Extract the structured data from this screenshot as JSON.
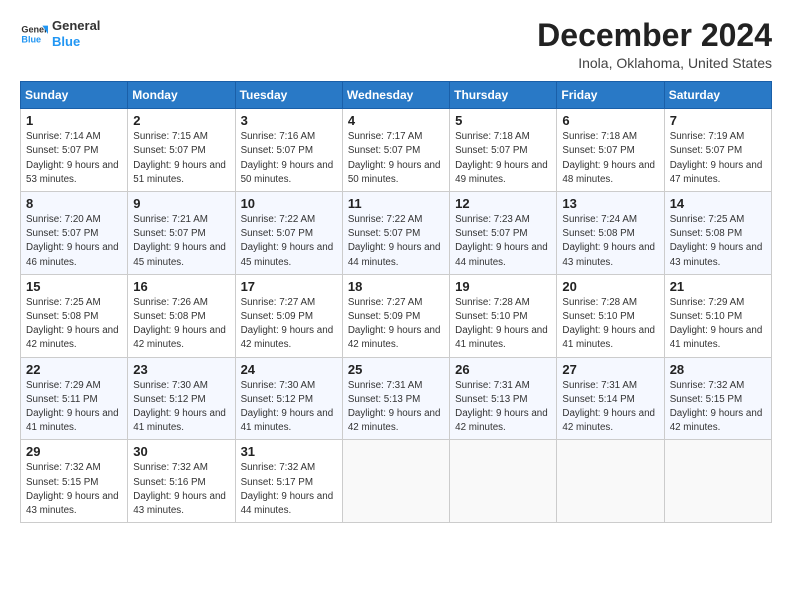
{
  "header": {
    "logo_line1": "General",
    "logo_line2": "Blue",
    "title": "December 2024",
    "subtitle": "Inola, Oklahoma, United States"
  },
  "calendar": {
    "headers": [
      "Sunday",
      "Monday",
      "Tuesday",
      "Wednesday",
      "Thursday",
      "Friday",
      "Saturday"
    ],
    "weeks": [
      [
        null,
        {
          "day": "2",
          "sunrise": "7:15 AM",
          "sunset": "5:07 PM",
          "daylight": "9 hours and 51 minutes."
        },
        {
          "day": "3",
          "sunrise": "7:16 AM",
          "sunset": "5:07 PM",
          "daylight": "9 hours and 50 minutes."
        },
        {
          "day": "4",
          "sunrise": "7:17 AM",
          "sunset": "5:07 PM",
          "daylight": "9 hours and 50 minutes."
        },
        {
          "day": "5",
          "sunrise": "7:18 AM",
          "sunset": "5:07 PM",
          "daylight": "9 hours and 49 minutes."
        },
        {
          "day": "6",
          "sunrise": "7:18 AM",
          "sunset": "5:07 PM",
          "daylight": "9 hours and 48 minutes."
        },
        {
          "day": "7",
          "sunrise": "7:19 AM",
          "sunset": "5:07 PM",
          "daylight": "9 hours and 47 minutes."
        }
      ],
      [
        {
          "day": "1",
          "sunrise": "7:14 AM",
          "sunset": "5:07 PM",
          "daylight": "9 hours and 53 minutes."
        },
        {
          "day": "9",
          "sunrise": "7:21 AM",
          "sunset": "5:07 PM",
          "daylight": "9 hours and 45 minutes."
        },
        {
          "day": "10",
          "sunrise": "7:22 AM",
          "sunset": "5:07 PM",
          "daylight": "9 hours and 45 minutes."
        },
        {
          "day": "11",
          "sunrise": "7:22 AM",
          "sunset": "5:07 PM",
          "daylight": "9 hours and 44 minutes."
        },
        {
          "day": "12",
          "sunrise": "7:23 AM",
          "sunset": "5:07 PM",
          "daylight": "9 hours and 44 minutes."
        },
        {
          "day": "13",
          "sunrise": "7:24 AM",
          "sunset": "5:08 PM",
          "daylight": "9 hours and 43 minutes."
        },
        {
          "day": "14",
          "sunrise": "7:25 AM",
          "sunset": "5:08 PM",
          "daylight": "9 hours and 43 minutes."
        }
      ],
      [
        {
          "day": "8",
          "sunrise": "7:20 AM",
          "sunset": "5:07 PM",
          "daylight": "9 hours and 46 minutes."
        },
        {
          "day": "16",
          "sunrise": "7:26 AM",
          "sunset": "5:08 PM",
          "daylight": "9 hours and 42 minutes."
        },
        {
          "day": "17",
          "sunrise": "7:27 AM",
          "sunset": "5:09 PM",
          "daylight": "9 hours and 42 minutes."
        },
        {
          "day": "18",
          "sunrise": "7:27 AM",
          "sunset": "5:09 PM",
          "daylight": "9 hours and 42 minutes."
        },
        {
          "day": "19",
          "sunrise": "7:28 AM",
          "sunset": "5:10 PM",
          "daylight": "9 hours and 41 minutes."
        },
        {
          "day": "20",
          "sunrise": "7:28 AM",
          "sunset": "5:10 PM",
          "daylight": "9 hours and 41 minutes."
        },
        {
          "day": "21",
          "sunrise": "7:29 AM",
          "sunset": "5:10 PM",
          "daylight": "9 hours and 41 minutes."
        }
      ],
      [
        {
          "day": "15",
          "sunrise": "7:25 AM",
          "sunset": "5:08 PM",
          "daylight": "9 hours and 42 minutes."
        },
        {
          "day": "23",
          "sunrise": "7:30 AM",
          "sunset": "5:12 PM",
          "daylight": "9 hours and 41 minutes."
        },
        {
          "day": "24",
          "sunrise": "7:30 AM",
          "sunset": "5:12 PM",
          "daylight": "9 hours and 41 minutes."
        },
        {
          "day": "25",
          "sunrise": "7:31 AM",
          "sunset": "5:13 PM",
          "daylight": "9 hours and 42 minutes."
        },
        {
          "day": "26",
          "sunrise": "7:31 AM",
          "sunset": "5:13 PM",
          "daylight": "9 hours and 42 minutes."
        },
        {
          "day": "27",
          "sunrise": "7:31 AM",
          "sunset": "5:14 PM",
          "daylight": "9 hours and 42 minutes."
        },
        {
          "day": "28",
          "sunrise": "7:32 AM",
          "sunset": "5:15 PM",
          "daylight": "9 hours and 42 minutes."
        }
      ],
      [
        {
          "day": "22",
          "sunrise": "7:29 AM",
          "sunset": "5:11 PM",
          "daylight": "9 hours and 41 minutes."
        },
        {
          "day": "30",
          "sunrise": "7:32 AM",
          "sunset": "5:16 PM",
          "daylight": "9 hours and 43 minutes."
        },
        {
          "day": "31",
          "sunrise": "7:32 AM",
          "sunset": "5:17 PM",
          "daylight": "9 hours and 44 minutes."
        },
        null,
        null,
        null,
        null
      ],
      [
        {
          "day": "29",
          "sunrise": "7:32 AM",
          "sunset": "5:15 PM",
          "daylight": "9 hours and 43 minutes."
        },
        null,
        null,
        null,
        null,
        null,
        null
      ]
    ]
  }
}
